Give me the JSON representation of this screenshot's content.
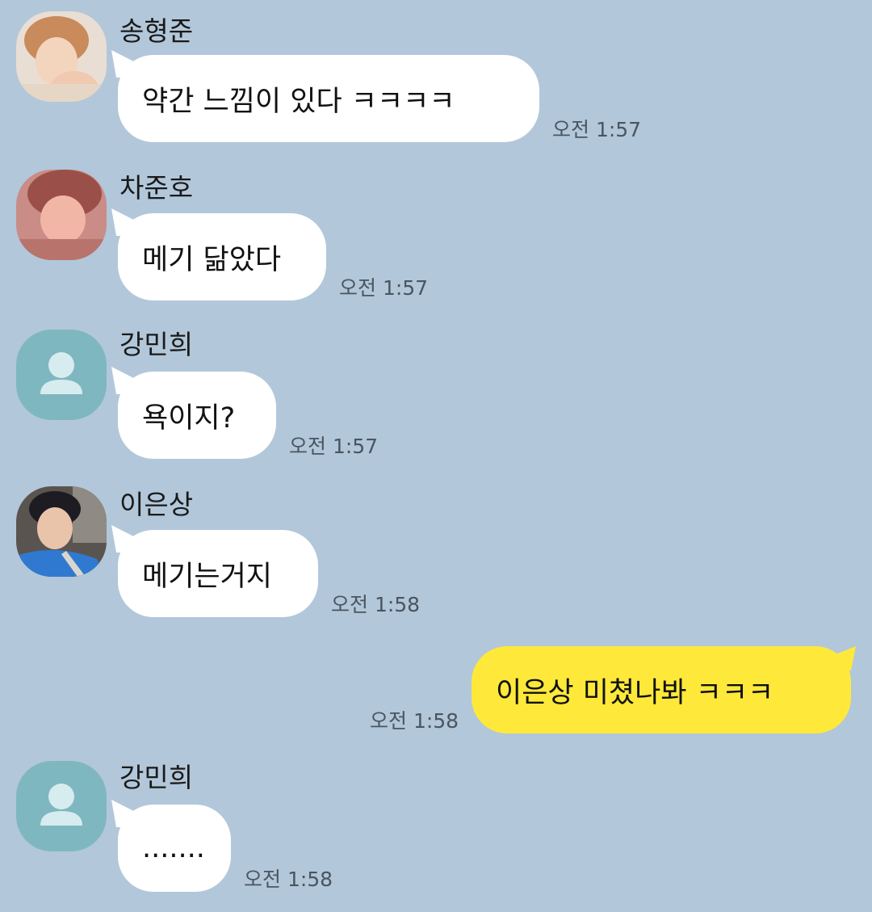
{
  "colors": {
    "background": "#b2c7da",
    "incoming_bubble": "#ffffff",
    "outgoing_bubble": "#fee93a",
    "default_avatar_bg": "#7fb7c0"
  },
  "messages": [
    {
      "sender": "송형준",
      "text": "약간 느낌이 있다 ㅋㅋㅋㅋ",
      "time": "오전 1:57",
      "avatar": "photo-avatar"
    },
    {
      "sender": "차준호",
      "text": "메기 닮았다",
      "time": "오전 1:57",
      "avatar": "photo-avatar"
    },
    {
      "sender": "강민희",
      "text": "욕이지?",
      "time": "오전 1:57",
      "avatar": "default-person-icon"
    },
    {
      "sender": "이은상",
      "text": "메기는거지",
      "time": "오전 1:58",
      "avatar": "photo-avatar"
    },
    {
      "sender": "",
      "text": "이은상 미쳤나봐 ㅋㅋㅋ",
      "time": "오전 1:58",
      "outgoing": true
    },
    {
      "sender": "강민희",
      "text": ".......",
      "time": "오전 1:58",
      "avatar": "default-person-icon"
    }
  ]
}
